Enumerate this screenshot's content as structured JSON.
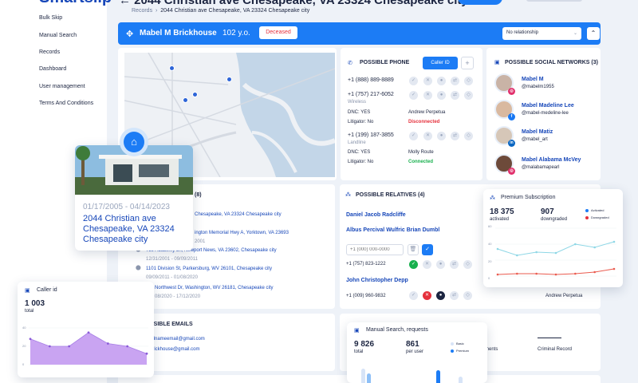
{
  "sidebar": {
    "brand": "Smartslip",
    "items": [
      {
        "label": "Bulk Skip"
      },
      {
        "label": "Manual Search"
      },
      {
        "label": "Records"
      },
      {
        "label": "Dashboard"
      },
      {
        "label": "User management"
      },
      {
        "label": "Terms And Conditions"
      }
    ]
  },
  "header": {
    "title": "2044 Christian ave Chesapeake, VA 23324 Chesapeake city",
    "breadcrumb_root": "Records",
    "breadcrumb_current": "2044 Christian ave Chesapeake, VA 23324 Chesapeake city"
  },
  "person": {
    "name": "Mabel M Brickhouse",
    "age": "102 y.o.",
    "status": "Deceased",
    "relation_select": "No relationship"
  },
  "phones": {
    "title": "POSSIBLE PHONE",
    "caller_id_button": "Caller ID",
    "items": [
      {
        "number": "+1 (888) 889-8889"
      },
      {
        "number": "+1 (757) 217-6052",
        "type": "Wireless",
        "dnc": "DNC: YES",
        "litigator": "Litigator: No",
        "owner": "Andrew Perpetua",
        "status": "Disconnected"
      },
      {
        "number": "+1 (199) 187-3855",
        "type": "Landline",
        "dnc": "DNC: YES",
        "litigator": "Litigator: No",
        "owner": "Molly Route",
        "status": "Connected"
      }
    ]
  },
  "social": {
    "title": "POSSIBLE SOCIAL NETWORKS (3)",
    "items": [
      {
        "name": "Mabel M",
        "handle": "@mabelm1955"
      },
      {
        "name": "Mabel Madeline Lee",
        "handle": "@mabel-medeline-lee"
      },
      {
        "name": "Mabel Matiz",
        "handle": "@mabel_art"
      },
      {
        "name": "Mabel Alabama McVey",
        "handle": "@malabamapearl"
      }
    ]
  },
  "addresses": {
    "count": "(8)",
    "items": [
      {
        "line": "Chesapeake, VA 23324 Chesapeake city",
        "dates": ""
      },
      {
        "line": "ington Memorial Hwy A, Yorktown, VA 23693",
        "dates": "2001"
      },
      {
        "line": "759 Academy Ln, Newport News, VA 23602, Chesapeake city",
        "dates": "12/31/2001 - 09/09/2011"
      },
      {
        "line": "1101 Division St, Parkersburg, WV 26101, Chesapeake city",
        "dates": "09/09/2011 - 01/08/2020"
      },
      {
        "line": "Northwest Dr, Washington, WV 26181, Chesapeake city",
        "dates": "08/2020 - 17/12/2020"
      }
    ]
  },
  "address_popup": {
    "dates": "01/17/2005 - 04/14/2023",
    "address": "2044 Christian ave Chesapeake, VA 23324 Chesapeake city"
  },
  "relatives": {
    "title": "POSSIBLE RELATIVES (4)",
    "items": [
      {
        "name": "Daniel Jacob Radcliffe"
      },
      {
        "name": "Albus Percival Wulfric Brian Dumbl",
        "phone_placeholder": "+1 (000) 000-0000",
        "phone": "+1 (757) 823-1222"
      },
      {
        "name": "John Christopher Depp",
        "phone": "+1 (009) 960-9832",
        "owner": "Andrew Perpetua"
      }
    ]
  },
  "emails": {
    "title": "SSIBLE EMAILS",
    "items": [
      {
        "address": "ailnameemail@gmail.com"
      },
      {
        "address": "brickhouse@gmail.com"
      }
    ]
  },
  "extra": {
    "col1": "ments",
    "col2": "Criminal Record"
  },
  "subscription": {
    "title": "Premium Subscription",
    "activated_value": "18 375",
    "activated_label": "activated",
    "downgraded_value": "907",
    "downgraded_label": "downgraded",
    "legend": [
      "Activated",
      "Downgraded"
    ],
    "ylabels": [
      "60",
      "40",
      "20",
      "0"
    ],
    "chart_data": {
      "type": "line",
      "series": [
        {
          "name": "Activated",
          "values": [
            34,
            26,
            30,
            29,
            40,
            36,
            43
          ]
        },
        {
          "name": "Downgraded",
          "values": [
            2,
            3,
            3,
            2,
            3,
            5,
            9
          ]
        }
      ],
      "ylim": [
        0,
        60
      ]
    }
  },
  "caller": {
    "title": "Caller id",
    "value": "1 003",
    "label": "total",
    "ylabels": [
      "40",
      "20",
      "0"
    ],
    "chart_data": {
      "type": "area",
      "values": [
        28,
        20,
        20,
        35,
        23,
        20,
        12
      ],
      "ylim": [
        0,
        40
      ]
    }
  },
  "manual": {
    "title": "Manual Search, requests",
    "total_value": "9 826",
    "total_label": "total",
    "per_user_value": "861",
    "per_user_label": "per user",
    "legend": [
      "Basic",
      "Premium"
    ]
  },
  "colors": {
    "primary": "#1c7cf5",
    "dark": "#1c2541",
    "link": "#1747b9",
    "danger": "#e5303c",
    "success": "#18b04e",
    "chart_area": "#c9a4f2"
  }
}
